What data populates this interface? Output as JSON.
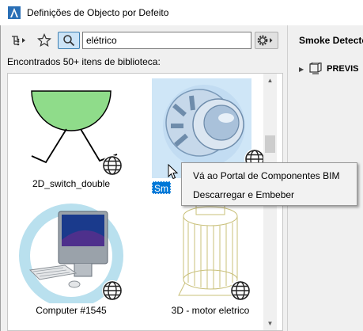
{
  "window": {
    "title": "Definições de Objecto por Defeito",
    "icon": "archicad-logo-icon"
  },
  "toolbar": {
    "nav_icon": "library-tree-icon",
    "favorites_icon": "star-icon",
    "search_icon": "magnifier-icon",
    "search_value": "elétrico",
    "settings_icon": "gear-icon"
  },
  "results": {
    "found_label": "Encontrados 50+ itens de biblioteca:"
  },
  "library_items": [
    {
      "caption": "2D_switch_double",
      "badge_icon": "globe-icon",
      "thumbnail": "switch-symbol"
    },
    {
      "caption": "Sm",
      "badge_icon": "globe-icon",
      "thumbnail": "smoke-detector",
      "selected": true
    },
    {
      "caption": "Computer #1545",
      "badge_icon": "globe-icon",
      "thumbnail": "imac-computer"
    },
    {
      "caption": "3D - motor eletrico",
      "badge_icon": "globe-icon",
      "thumbnail": "electric-motor"
    }
  ],
  "scrollbar": {
    "up_icon": "scroll-up-arrow",
    "down_icon": "scroll-down-arrow"
  },
  "preview_panel": {
    "title": "Smoke Detector",
    "section_label": "PREVIS",
    "section_icon": "preview-icon"
  },
  "context_menu": {
    "items": [
      {
        "label": "Vá ao Portal de Componentes BIM"
      },
      {
        "label": "Descarregar e Embeber"
      }
    ]
  },
  "colors": {
    "selection": "#0078d7",
    "selection_light": "#cfe6f7",
    "switch_fill": "#8fdc8a"
  }
}
